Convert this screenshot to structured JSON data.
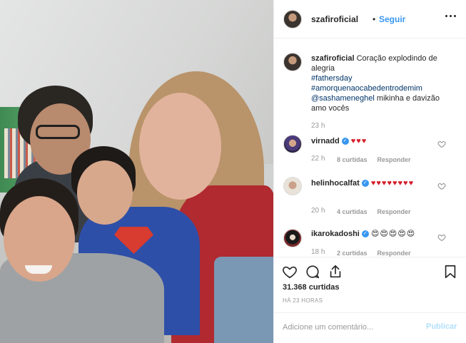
{
  "post": {
    "author": "szafiroficial",
    "follow_label": "Seguir",
    "separator": "•",
    "caption": {
      "author": "szafiroficial",
      "text": "Coração explodindo de alegria",
      "hashtag1": "#fathersday",
      "hashtag2": "#amorquenaocabedentrodemim",
      "mention": "@sashameneghel",
      "text2": "mikinha e davizão amo vocês",
      "time": "23 h"
    },
    "comments": [
      {
        "user": "virnadd",
        "text": "♥♥♥",
        "time": "22 h",
        "likes": "8 curtidas",
        "reply": "Responder"
      },
      {
        "user": "helinhocalfat",
        "text": "♥♥♥♥♥♥♥♥",
        "time": "20 h",
        "likes": "4 curtidas",
        "reply": "Responder"
      },
      {
        "user": "ikarokadoshi",
        "text": "😍😍😍😍😍",
        "time": "18 h",
        "likes": "2 curtidas",
        "reply": "Responder"
      }
    ],
    "likes_count": "31.368 curtidas",
    "posted_ago": "HÁ 23 HORAS",
    "comment_placeholder": "Adicione um comentário...",
    "publish_label": "Publicar"
  },
  "icons": {
    "like": "heart-icon",
    "comment": "comment-icon",
    "share": "share-icon",
    "save": "bookmark-icon",
    "more": "more-options-icon",
    "verified": "verified-badge-icon"
  },
  "colors": {
    "link": "#3897f0",
    "hashtag": "#003569",
    "muted": "#999999",
    "publish_disabled": "#b2dffc",
    "heart_red": "#d61f2c",
    "heart_teal": "#25b5b5"
  }
}
